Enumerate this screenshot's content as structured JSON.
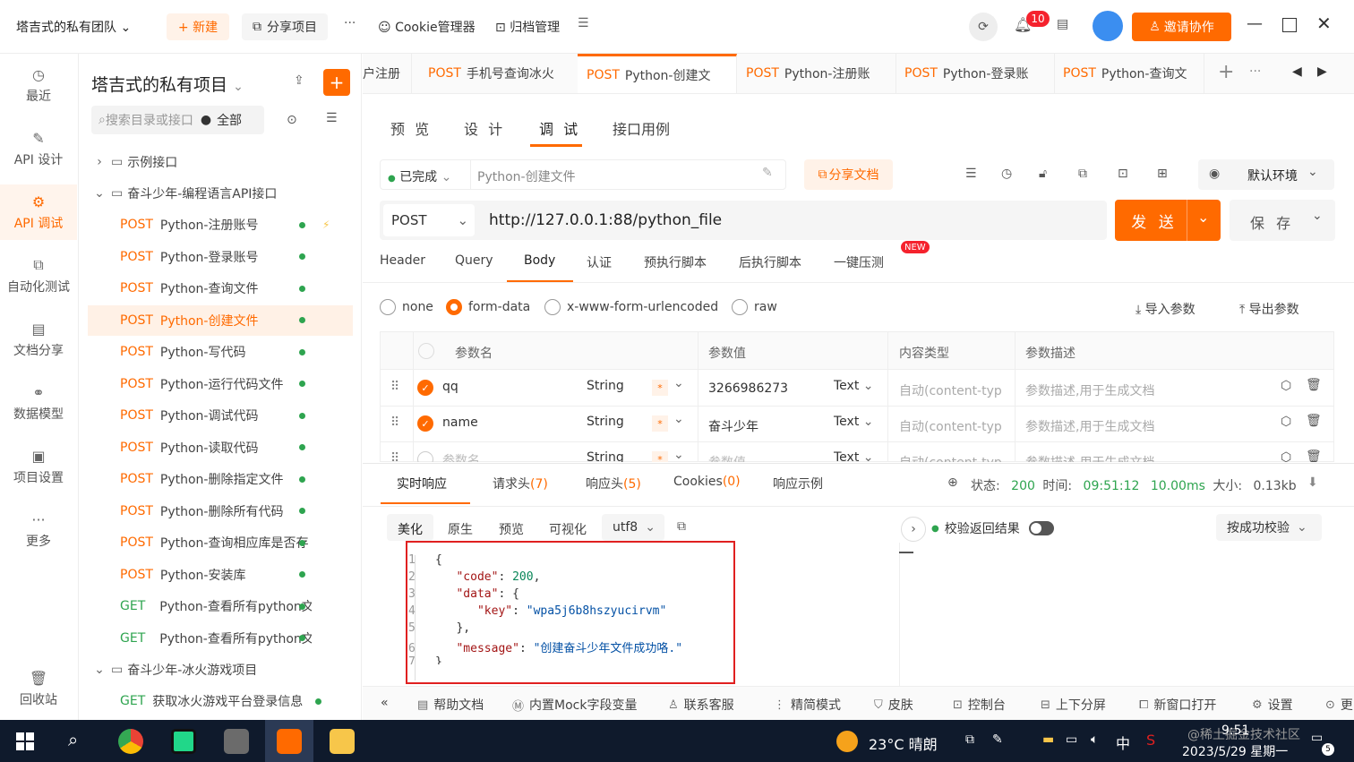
{
  "topbar": {
    "team": "塔吉式的私有团队",
    "new_btn": "+ 新建",
    "share_project": "分享项目",
    "more": "···",
    "cookie": "Cookie管理器",
    "archive": "归档管理",
    "notif_count": "10",
    "invite": "邀请协作"
  },
  "rail": {
    "items": [
      {
        "label": "最近"
      },
      {
        "label": "API 设计"
      },
      {
        "label": "API 调试"
      },
      {
        "label": "自动化测试"
      },
      {
        "label": "文档分享"
      },
      {
        "label": "数据模型"
      },
      {
        "label": "项目设置"
      },
      {
        "label": "更多"
      },
      {
        "label": "回收站"
      }
    ]
  },
  "tree": {
    "title": "塔吉式的私有项目",
    "search_placeholder": "搜索目录或接口",
    "filter": "全部",
    "folder_example": "示例接口",
    "folder_main": "奋斗少年-编程语言API接口",
    "items": [
      {
        "method": "POST",
        "name": "Python-注册账号"
      },
      {
        "method": "POST",
        "name": "Python-登录账号"
      },
      {
        "method": "POST",
        "name": "Python-查询文件"
      },
      {
        "method": "POST",
        "name": "Python-创建文件"
      },
      {
        "method": "POST",
        "name": "Python-写代码"
      },
      {
        "method": "POST",
        "name": "Python-运行代码文件"
      },
      {
        "method": "POST",
        "name": "Python-调试代码"
      },
      {
        "method": "POST",
        "name": "Python-读取代码"
      },
      {
        "method": "POST",
        "name": "Python-删除指定文件"
      },
      {
        "method": "POST",
        "name": "Python-删除所有代码"
      },
      {
        "method": "POST",
        "name": "Python-查询相应库是否存"
      },
      {
        "method": "POST",
        "name": "Python-安装库"
      },
      {
        "method": "GET",
        "name": "Python-查看所有python文"
      },
      {
        "method": "GET",
        "name": "Python-查看所有python文"
      }
    ],
    "folder_game": "奋斗少年-冰火游戏项目",
    "game_item": {
      "method": "GET",
      "name": "获取冰火游戏平台登录信息"
    }
  },
  "tabs": {
    "items": [
      {
        "method": "",
        "name": "户注册"
      },
      {
        "method": "POST",
        "name": "手机号查询冰火"
      },
      {
        "method": "POST",
        "name": "Python-创建文"
      },
      {
        "method": "POST",
        "name": "Python-注册账"
      },
      {
        "method": "POST",
        "name": "Python-登录账"
      },
      {
        "method": "POST",
        "name": "Python-查询文"
      }
    ]
  },
  "subtabs": [
    "预 览",
    "设 计",
    "调 试",
    "接口用例"
  ],
  "status_bar": {
    "status": "已完成",
    "name": "Python-创建文件",
    "share_doc": "分享文档",
    "env": "默认环境"
  },
  "request": {
    "method": "POST",
    "url": "http://127.0.0.1:88/python_file",
    "send": "发 送",
    "save": "保 存"
  },
  "body_tabs": [
    "Header",
    "Query",
    "Body",
    "认证",
    "预执行脚本",
    "后执行脚本",
    "一键压测"
  ],
  "new_badge": "NEW",
  "body_types": [
    "none",
    "form-data",
    "x-www-form-urlencoded",
    "raw"
  ],
  "import_params": "导入参数",
  "export_params": "导出参数",
  "table": {
    "headers": [
      "参数名",
      "参数值",
      "内容类型",
      "参数描述"
    ],
    "rows": [
      {
        "name": "qq",
        "type": "String",
        "value": "3266986273",
        "vtype": "Text",
        "ctype": "自动(content-typ",
        "desc": "参数描述,用于生成文档"
      },
      {
        "name": "name",
        "type": "String",
        "value": "奋斗少年",
        "vtype": "Text",
        "ctype": "自动(content-typ",
        "desc": "参数描述,用于生成文档"
      },
      {
        "name": "参数名",
        "type": "String",
        "value": "参数值",
        "vtype": "Text",
        "ctype": "自动(content-typ",
        "desc": "参数描述,用于生成文档"
      }
    ]
  },
  "response": {
    "tabs": [
      "实时响应",
      "请求头(7)",
      "响应头(5)",
      "Cookies(0)",
      "响应示例"
    ],
    "status_label": "状态:",
    "status": "200",
    "time_label": "时间:",
    "time": "09:51:12",
    "duration": "10.00ms",
    "size_label": "大小:",
    "size": "0.13kb",
    "format_tabs": [
      "美化",
      "原生",
      "预览",
      "可视化"
    ],
    "encoding": "utf8",
    "validate": "校验返回结果",
    "validate_mode": "按成功校验",
    "code": {
      "l1": "{",
      "k_code": "\"code\"",
      "v_code": "200",
      "k_data": "\"data\"",
      "k_key": "\"key\"",
      "v_key": "\"wpa5j6b8hszyucirvm\"",
      "close_data": "},",
      "k_message": "\"message\"",
      "v_message": "\"创建奋斗少年文件成功咯.\"",
      "l7": "}"
    }
  },
  "bottom": [
    "帮助文档",
    "内置Mock字段变量",
    "联系客服",
    "精简模式",
    "皮肤",
    "控制台",
    "上下分屏",
    "新窗口打开",
    "设置",
    "更"
  ],
  "taskbar": {
    "weather": "23°C 晴朗",
    "ime": "中",
    "time": "9:51",
    "date": "2023/5/29 星期一",
    "notif": "5",
    "watermark": "@稀土掘金技术社区"
  }
}
